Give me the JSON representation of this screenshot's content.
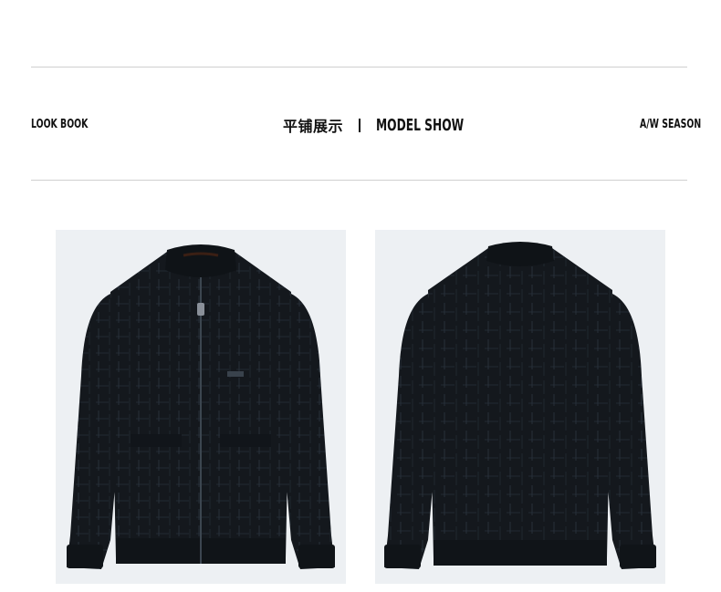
{
  "header": {
    "left_tag": "LOOK BOOK",
    "title_cn": "平铺展示",
    "title_en": "MODEL SHOW",
    "right_tag": "A/W SEASON"
  },
  "gallery": {
    "images": [
      {
        "view": "front",
        "icon": "jacket-front-icon"
      },
      {
        "view": "back",
        "icon": "jacket-back-icon"
      }
    ]
  },
  "colors": {
    "jacket": "#14181d",
    "background": "#edf0f3",
    "rule": "#cfcfcf",
    "text": "#111111"
  }
}
